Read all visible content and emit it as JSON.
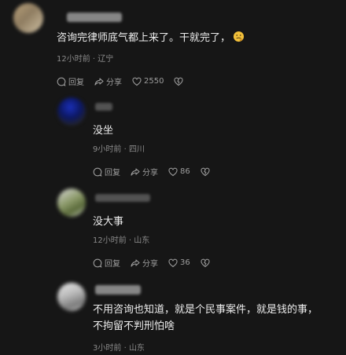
{
  "comments": [
    {
      "text": "咨询完律师底气都上来了。干就完了，",
      "emoji": "thinking-face-emoji",
      "time": "12小时前",
      "location": "辽宁",
      "reply": "回复",
      "share": "分享",
      "likes": "2550"
    },
    {
      "text": "没坐",
      "time": "9小时前",
      "location": "四川",
      "reply": "回复",
      "share": "分享",
      "likes": "86"
    },
    {
      "text": "没大事",
      "time": "12小时前",
      "location": "山东",
      "reply": "回复",
      "share": "分享",
      "likes": "36"
    },
    {
      "text_line1": "不用咨询也知道，就是个民事案件，就是钱的事，",
      "text_line2": "不拘留不判刑怕啥",
      "time": "3小时前",
      "location": "山东"
    }
  ],
  "meta_separator": "·"
}
